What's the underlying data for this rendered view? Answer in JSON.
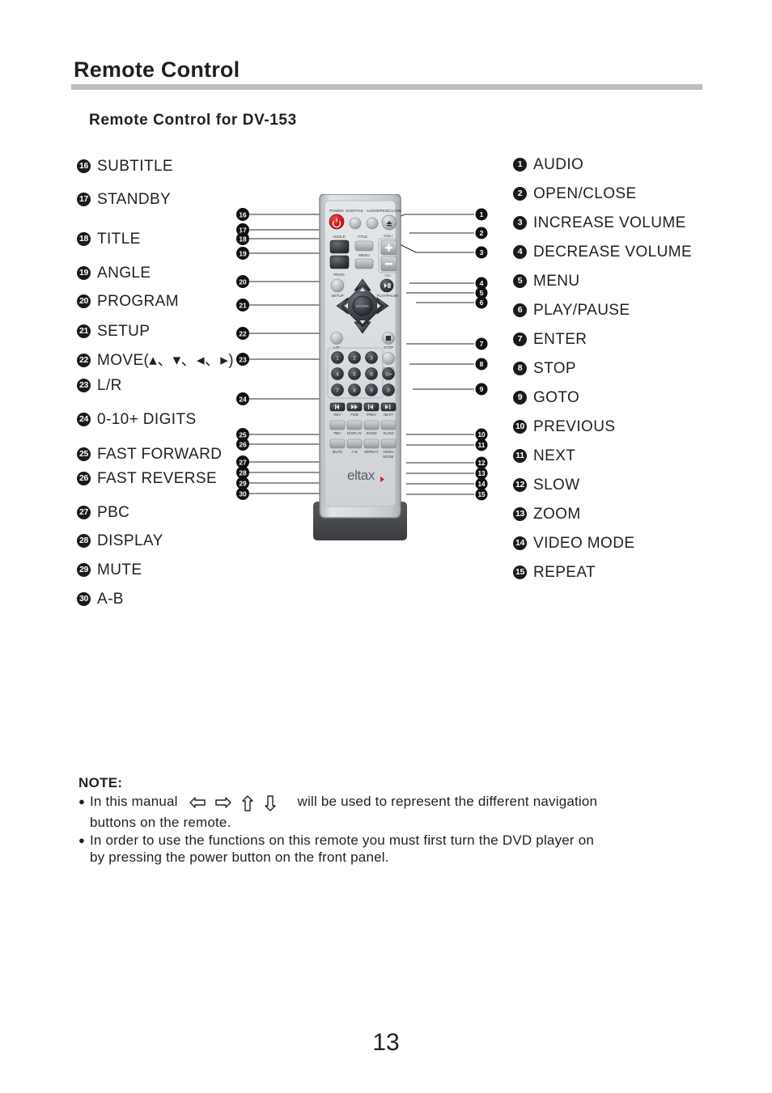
{
  "header": {
    "title": "Remote Control",
    "subtitle": "Remote Control for DV-153"
  },
  "legend_left": [
    {
      "num": "16",
      "label": "SUBTITLE"
    },
    {
      "num": "17",
      "label": "STANDBY"
    },
    {
      "num": "18",
      "label": "TITLE"
    },
    {
      "num": "19",
      "label": "ANGLE"
    },
    {
      "num": "20",
      "label": "PROGRAM"
    },
    {
      "num": "21",
      "label": "SETUP"
    },
    {
      "num": "22",
      "label": "MOVE(▴、▾、◂、▸)"
    },
    {
      "num": "23",
      "label": "L/R"
    },
    {
      "num": "24",
      "label": "0-10+ DIGITS"
    },
    {
      "num": "25",
      "label": "FAST FORWARD"
    },
    {
      "num": "26",
      "label": "FAST REVERSE"
    },
    {
      "num": "27",
      "label": "PBC"
    },
    {
      "num": "28",
      "label": "DISPLAY"
    },
    {
      "num": "29",
      "label": "MUTE"
    },
    {
      "num": "30",
      "label": "A-B"
    }
  ],
  "legend_right": [
    {
      "num": "1",
      "label": "AUDIO"
    },
    {
      "num": "2",
      "label": "OPEN/CLOSE"
    },
    {
      "num": "3",
      "label": "INCREASE VOLUME"
    },
    {
      "num": "4",
      "label": "DECREASE VOLUME"
    },
    {
      "num": "5",
      "label": "MENU"
    },
    {
      "num": "6",
      "label": "PLAY/PAUSE"
    },
    {
      "num": "7",
      "label": "ENTER"
    },
    {
      "num": "8",
      "label": "STOP"
    },
    {
      "num": "9",
      "label": "GOTO"
    },
    {
      "num": "10",
      "label": "PREVIOUS"
    },
    {
      "num": "11",
      "label": "NEXT"
    },
    {
      "num": "12",
      "label": "SLOW"
    },
    {
      "num": "13",
      "label": "ZOOM"
    },
    {
      "num": "14",
      "label": "VIDEO MODE"
    },
    {
      "num": "15",
      "label": "REPEAT"
    }
  ],
  "remote": {
    "brand": "eltax",
    "button_labels": {
      "power": "POWER",
      "subtitle": "SUBTITLE",
      "audio": "AUDIO",
      "open_close": "OPEN/CLOSE",
      "angle": "ANGLE",
      "title": "TITLE",
      "vol_up": "VOL+",
      "vol_down": "VOL-",
      "menu": "MENU",
      "prog": "PROG",
      "setup": "SETUP",
      "play_pause": "PLAY/PAUSE",
      "enter": "ENTER",
      "lr": "L/R",
      "stop": "STOP",
      "goto": "GOTO",
      "rev": "REV",
      "fwd": "FWD",
      "prev": "PREV",
      "next": "NEXT",
      "pbc": "PBC",
      "display": "DISPLAY",
      "zoom": "ZOOM",
      "slow": "SLOW",
      "mute": "MUTE",
      "ab": "A-B",
      "repeat": "REPEAT",
      "video_mode_1": "VIDEO",
      "video_mode_2": "MODE",
      "plus": "+",
      "minus": "–"
    },
    "keypad": [
      "1",
      "2",
      "3",
      "4",
      "5",
      "6",
      "7",
      "8",
      "9",
      "10+",
      "0"
    ],
    "colors": {
      "power_button": "#d81f26",
      "body": "#d6d8da",
      "body_edge": "#9a9ea3",
      "base": "#4a4a4a",
      "key_dark": "#3b3f45",
      "key_light": "#b9bcc0"
    }
  },
  "note": {
    "title": "NOTE:",
    "line1_a": "In this manual",
    "line1_b": "will be used to represent the different navigation",
    "line1_c": "buttons on the remote.",
    "line2_a": "In order to use the functions on this remote you must first turn the DVD player on",
    "line2_b": "by pressing the power button on the front panel."
  },
  "page_number": "13"
}
